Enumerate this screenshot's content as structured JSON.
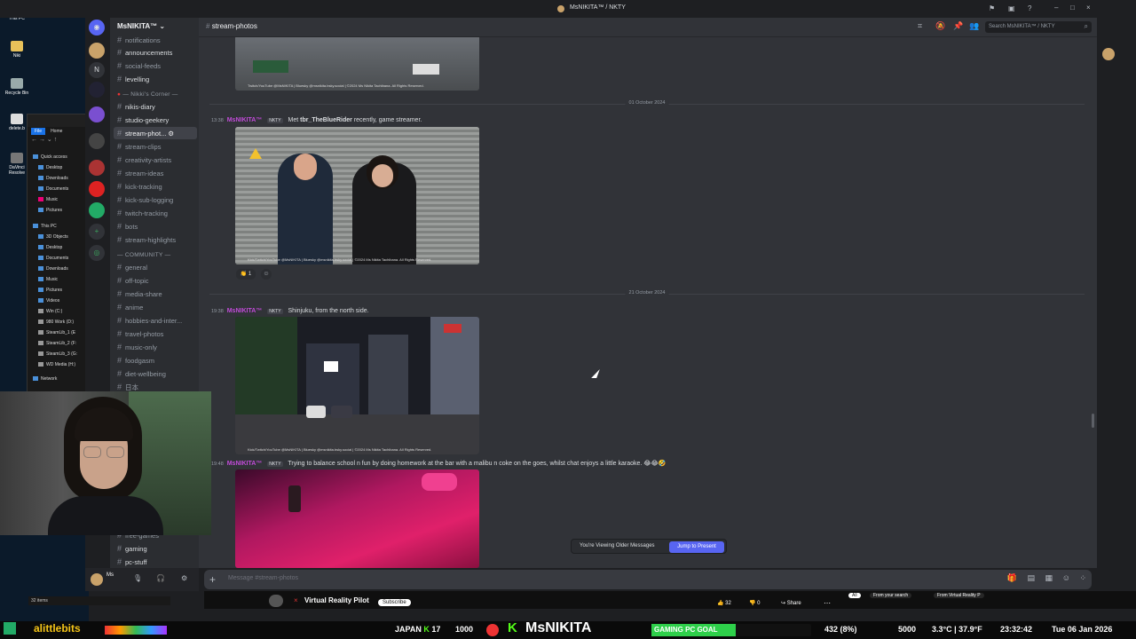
{
  "window_title": "MsNIKITA™ / NKTY",
  "desktop": {
    "icons": [
      "This PC",
      "Niki",
      "Recycle Bin",
      "delete.b",
      "DaVinci Resolve"
    ]
  },
  "explorer": {
    "tabs": [
      "File",
      "Home"
    ],
    "quick_access": "Quick access",
    "quick_items": [
      "Desktop",
      "Downloads",
      "Documents",
      "Music",
      "Pictures"
    ],
    "this_pc": "This PC",
    "pc_items": [
      "3D Objects",
      "Desktop",
      "Documents",
      "Downloads",
      "Music",
      "Pictures",
      "Videos",
      "Win (C:)",
      "980 Work (D:)",
      "SteamLib_1 (E",
      "SteamLib_2 (F:",
      "SteamLib_3 (G:",
      "WD Media (H:)"
    ],
    "network": "Network",
    "status": "32 items"
  },
  "server": {
    "name": "MsNIKITA™"
  },
  "channels": {
    "top": [
      "notifications",
      "announcements",
      "social-feeds",
      "levelling"
    ],
    "cat1": "Nikki's Corner",
    "cat1_items": [
      "nikis-diary",
      "studio-geekery",
      "stream-phot...",
      "stream-clips",
      "creativity-artists",
      "stream-ideas",
      "kick-tracking",
      "kick-sub-logging",
      "twitch-tracking",
      "bots",
      "stream-highlights"
    ],
    "cat2": "COMMUNITY",
    "cat2_items": [
      "general",
      "off-topic",
      "media-share",
      "anime",
      "hobbies-and-inter...",
      "travel-photos",
      "music-only",
      "foodgasm",
      "diet-wellbeing",
      "日本"
    ],
    "bottom": [
      "free-games",
      "gaming",
      "pc-stuff"
    ]
  },
  "header": {
    "channel": "stream-photos",
    "search_placeholder": "Search MsNIKITA™ / NKTY"
  },
  "messages": {
    "first_caption": "Twitch/YouTube @MsNIKITA | Bluesky @msnikita.bsky.social | ©2024 Ms Nikita Tachibana. All Rights Reserved.",
    "date1": "01 October 2024",
    "m1": {
      "time": "13:38",
      "author": "MsNIKITA™",
      "tag": "NKTY",
      "text_pre": "Met ",
      "text_bold": "tbr_TheBlueRider",
      "text_post": " recently, game streamer.",
      "watermark": "Kick/Twitch/YouTube @MsNIKITA | Bluesky @msnikita.bsky.social | ©2024 Ms Nikita Tachibana. All Rights Reserved.",
      "reaction_count": "1"
    },
    "date2": "21 October 2024",
    "m2": {
      "time": "19:38",
      "author": "MsNIKITA™",
      "tag": "NKTY",
      "text": "Shinjuku, from the north side.",
      "watermark": "Kick/Twitch/YouTube @MsNIKITA | Bluesky @msnikita.bsky.social | ©2024 Ms Nikita Tachibana. All Rights Reserved."
    },
    "m3": {
      "time": "19:48",
      "author": "MsNIKITA™",
      "tag": "NKTY",
      "text": "Trying to balance school n fun by doing homework at the bar with a malibu n coke on the goes, whilst chat enjoys a little karaoke. 😂😂🤣"
    }
  },
  "jump": {
    "notice": "You're Viewing Older Messages",
    "button": "Jump to Present"
  },
  "composer": {
    "placeholder": "Message #stream-photos"
  },
  "youtube": {
    "channel": "Virtual Reality Pilot",
    "subscribe": "Subscribe",
    "likes": "32",
    "dislikes": "0",
    "share": "Share",
    "chips": [
      "All",
      "From your search",
      "From Virtual Reality P"
    ]
  },
  "taskbar": {
    "brand": "alittlebits",
    "japan": "JAPAN",
    "japan_a": "17",
    "japan_b": "1000",
    "name": "MsNIKITA",
    "goal": "GAMING PC GOAL",
    "goal_progress": "432 (8%)",
    "goal_target": "5000",
    "weather": "3.3°C | 37.9°F",
    "time": "23:32:42",
    "date": "Tue 06 Jan 2026"
  },
  "colors": {
    "accent": "#5865f2",
    "author": "#c14bd8",
    "goal_green": "#2ed04a",
    "kick_green": "#53fc18"
  }
}
